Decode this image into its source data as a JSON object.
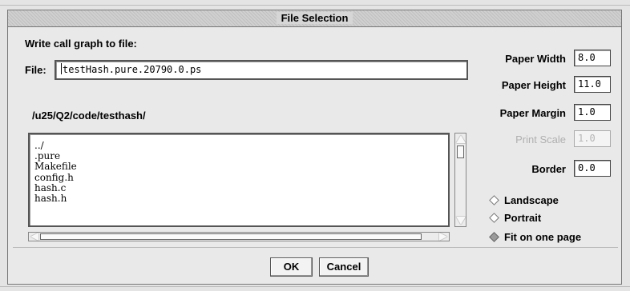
{
  "window": {
    "title": "File Selection"
  },
  "file_section": {
    "heading": "Write call graph to file:",
    "file_label": "File:",
    "file_value": "testHash.pure.20790.0.ps",
    "directory": "/u25/Q2/code/testhash/",
    "files": [
      "../",
      ".pure",
      "Makefile",
      "config.h",
      "hash.c",
      "hash.h"
    ]
  },
  "settings": {
    "paper_width_label": "Paper Width",
    "paper_width_value": "8.0",
    "paper_height_label": "Paper Height",
    "paper_height_value": "11.0",
    "paper_margin_label": "Paper Margin",
    "paper_margin_value": "1.0",
    "print_scale_label": "Print Scale",
    "print_scale_value": "1.0",
    "border_label": "Border",
    "border_value": "0.0"
  },
  "orientation": {
    "options": [
      {
        "label": "Landscape",
        "selected": false
      },
      {
        "label": "Portrait",
        "selected": false
      },
      {
        "label": "Fit on one page",
        "selected": true
      }
    ]
  },
  "buttons": {
    "ok_label": "OK",
    "cancel_label": "Cancel"
  }
}
